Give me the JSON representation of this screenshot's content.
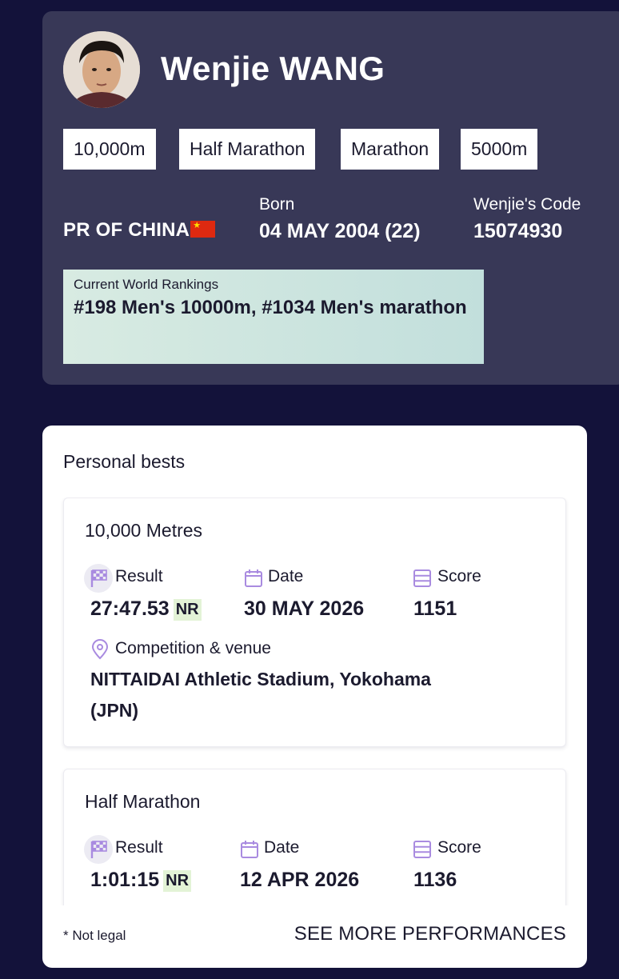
{
  "athlete": {
    "name": "Wenjie WANG",
    "events": [
      "10,000m",
      "Half Marathon",
      "Marathon",
      "5000m"
    ],
    "country": "PR OF CHINA",
    "born_label": "Born",
    "born_value": "04 MAY 2004 (22)",
    "code_label": "Wenjie's Code",
    "code_value": "15074930",
    "rankings_label": "Current World Rankings",
    "rankings_value": "#198 Men's 10000m, #1034 Men's marathon"
  },
  "personal_bests": {
    "title": "Personal bests",
    "items": [
      {
        "event": "10,000 Metres",
        "result_label": "Result",
        "result_value": "27:47.53",
        "result_badge": "NR",
        "date_label": "Date",
        "date_value": "30 MAY 2026",
        "score_label": "Score",
        "score_value": "1151",
        "venue_label": "Competition & venue",
        "venue_value": "NITTAIDAI Athletic Stadium, Yokohama (JPN)"
      },
      {
        "event": "Half Marathon",
        "result_label": "Result",
        "result_value": "1:01:15",
        "result_badge": "NR",
        "date_label": "Date",
        "date_value": "12 APR 2026",
        "score_label": "Score",
        "score_value": "1136"
      }
    ],
    "footnote": "* Not legal",
    "see_more": "SEE MORE PERFORMANCES"
  },
  "colors": {
    "page_bg": "#13123a",
    "header_card_bg": "#383857",
    "icon_purple": "#a98be0",
    "badge_green": "#e3f3d6"
  },
  "icons": {
    "result": "checkered-flag-icon",
    "date": "calendar-icon",
    "score": "list-icon",
    "venue": "location-pin-icon"
  }
}
